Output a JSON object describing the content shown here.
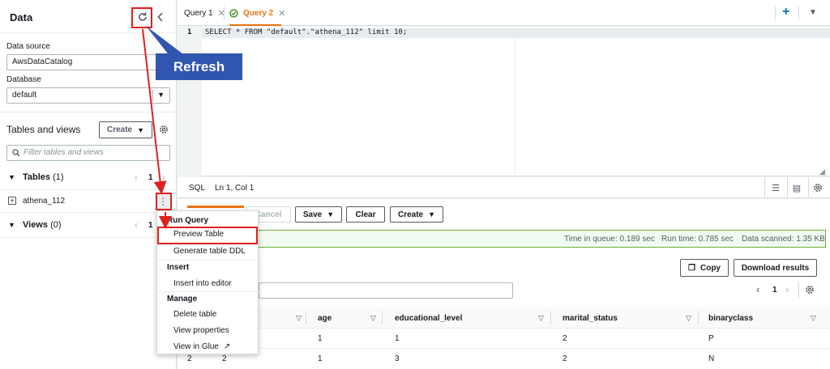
{
  "left_panel": {
    "title": "Data",
    "data_source_label": "Data source",
    "data_source_value": "AwsDataCatalog",
    "database_label": "Database",
    "database_value": "default",
    "tables_views_title": "Tables and views",
    "create_button": "Create",
    "filter_placeholder": "Filter tables and views",
    "tables_label": "Tables",
    "tables_count": "(1)",
    "tables_page": "1",
    "table_item": "athena_112",
    "views_label": "Views",
    "views_count": "(0)",
    "views_page": "1"
  },
  "tabs": [
    {
      "label": "Query 1"
    },
    {
      "label": "Query 2"
    }
  ],
  "editor": {
    "line_number": "1",
    "code": "SELECT * FROM \"default\".\"athena_112\" limit 10;",
    "language": "SQL",
    "cursor": "Ln 1, Col 1"
  },
  "toolbar": {
    "cancel": "Cancel",
    "save": "Save",
    "clear": "Clear",
    "create": "Create"
  },
  "status": {
    "queue": "Time in queue: 0.189 sec",
    "runtime": "Run time: 0.785 sec",
    "scanned": "Data scanned: 1.35 KB"
  },
  "results": {
    "copy": "Copy",
    "download": "Download results",
    "page": "1",
    "columns": [
      "age",
      "educational_level",
      "marital_status",
      "binaryclass"
    ],
    "rows": [
      {
        "c0": "",
        "c1": "",
        "age": "1",
        "edu": "1",
        "marital": "2",
        "binary": "P"
      },
      {
        "c0": "2",
        "c1": "2",
        "age": "1",
        "edu": "3",
        "marital": "2",
        "binary": "N"
      }
    ]
  },
  "context_menu": {
    "group1": "Run Query",
    "preview": "Preview Table",
    "ddl": "Generate table DDL",
    "group2": "Insert",
    "insert": "Insert into editor",
    "group3": "Manage",
    "delete": "Delete table",
    "properties": "View properties",
    "glue": "View in Glue"
  },
  "annotation": {
    "callout": "Refresh"
  },
  "colors": {
    "accent_orange": "#ec7211",
    "success_green": "#1d8102",
    "link_blue": "#0073bb",
    "annotation_red": "#e02020",
    "callout_blue": "#3056b0"
  }
}
